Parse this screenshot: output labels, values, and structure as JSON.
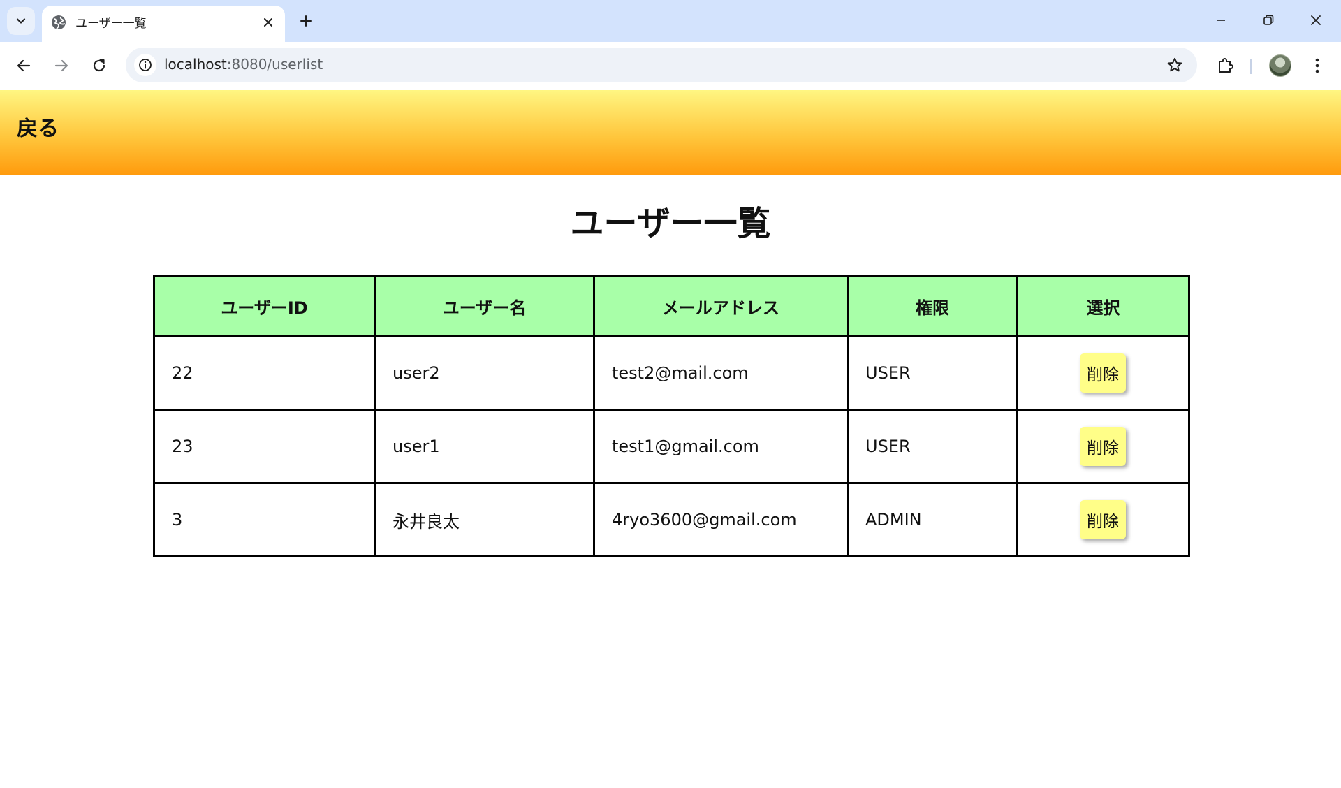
{
  "browser": {
    "tab": {
      "title": "ユーザー一覧"
    },
    "url": {
      "host": "localhost",
      "path": ":8080/userlist"
    }
  },
  "header": {
    "back_label": "戻る"
  },
  "page": {
    "title": "ユーザー一覧"
  },
  "table": {
    "columns": [
      "ユーザーID",
      "ユーザー名",
      "メールアドレス",
      "権限",
      "選択"
    ],
    "rows": [
      {
        "id": "22",
        "name": "user2",
        "email": "test2@mail.com",
        "role": "USER",
        "action": "削除"
      },
      {
        "id": "23",
        "name": "user1",
        "email": "test1@gmail.com",
        "role": "USER",
        "action": "削除"
      },
      {
        "id": "3",
        "name": "永井良太",
        "email": "4ryo3600@gmail.com",
        "role": "ADMIN",
        "action": "削除"
      }
    ]
  },
  "colors": {
    "header_gradient_top": "#fff682",
    "header_gradient_bottom": "#ff9a0c",
    "table_header_bg": "#a8ffa8",
    "delete_button_bg": "#fffe88"
  }
}
